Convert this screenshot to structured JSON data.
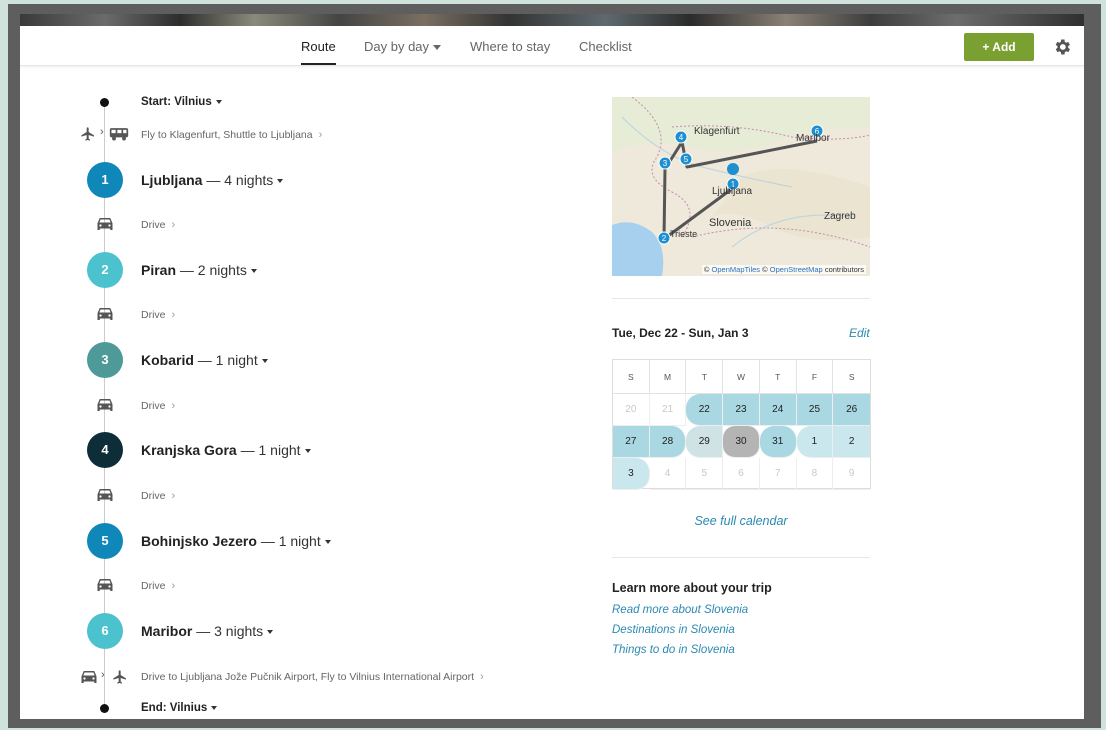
{
  "nav": {
    "tabs": [
      {
        "label": "Route"
      },
      {
        "label": "Day by day"
      },
      {
        "label": "Where to stay"
      },
      {
        "label": "Checklist"
      }
    ],
    "add_label": "+ Add"
  },
  "route": {
    "start": "Start: Vilnius",
    "first_leg": "Fly to Klagenfurt, Shuttle to Ljubljana",
    "stops": [
      {
        "num": "1",
        "name": "Ljubljana",
        "nights": "— 4 nights",
        "color": "#0f87b8",
        "leg": "Drive"
      },
      {
        "num": "2",
        "name": "Piran",
        "nights": "— 2 nights",
        "color": "#4cc2cf",
        "leg": "Drive"
      },
      {
        "num": "3",
        "name": "Kobarid",
        "nights": "— 1 night",
        "color": "#4d9a98",
        "leg": "Drive"
      },
      {
        "num": "4",
        "name": "Kranjska Gora",
        "nights": "— 1 night",
        "color": "#0d2d38",
        "leg": "Drive"
      },
      {
        "num": "5",
        "name": "Bohinjsko Jezero",
        "nights": "— 1 night",
        "color": "#0f87b8",
        "leg": "Drive"
      },
      {
        "num": "6",
        "name": "Maribor",
        "nights": "— 3 nights",
        "color": "#4cc2cf",
        "leg": ""
      }
    ],
    "last_leg": "Drive to Ljubljana Jože Pučnik Airport, Fly to Vilnius International Airport",
    "end": "End: Vilnius"
  },
  "map": {
    "labels": [
      "Klagenfurt",
      "Maribor",
      "Ljubljana",
      "Slovenia",
      "Zagreb",
      "Trieste"
    ],
    "attribution_prefix": "©",
    "attribution_link1": "OpenMapTiles",
    "attribution_mid": "©",
    "attribution_link2": "OpenStreetMap",
    "attribution_suffix": "contributors",
    "pins": [
      "1",
      "2",
      "3",
      "4",
      "5",
      "6"
    ]
  },
  "calendar": {
    "range": "Tue, Dec 22 - Sun, Jan 3",
    "edit": "Edit",
    "weekdays": [
      "S",
      "M",
      "T",
      "W",
      "T",
      "F",
      "S"
    ],
    "rows": [
      [
        "20",
        "21",
        "22",
        "23",
        "24",
        "25",
        "26"
      ],
      [
        "27",
        "28",
        "29",
        "30",
        "31",
        "1",
        "2"
      ],
      [
        "3",
        "4",
        "5",
        "6",
        "7",
        "8",
        "9"
      ]
    ],
    "see_full": "See full calendar"
  },
  "learn": {
    "title": "Learn more about your trip",
    "links": [
      "Read more about Slovenia",
      "Destinations in Slovenia",
      "Things to do in Slovenia"
    ]
  }
}
